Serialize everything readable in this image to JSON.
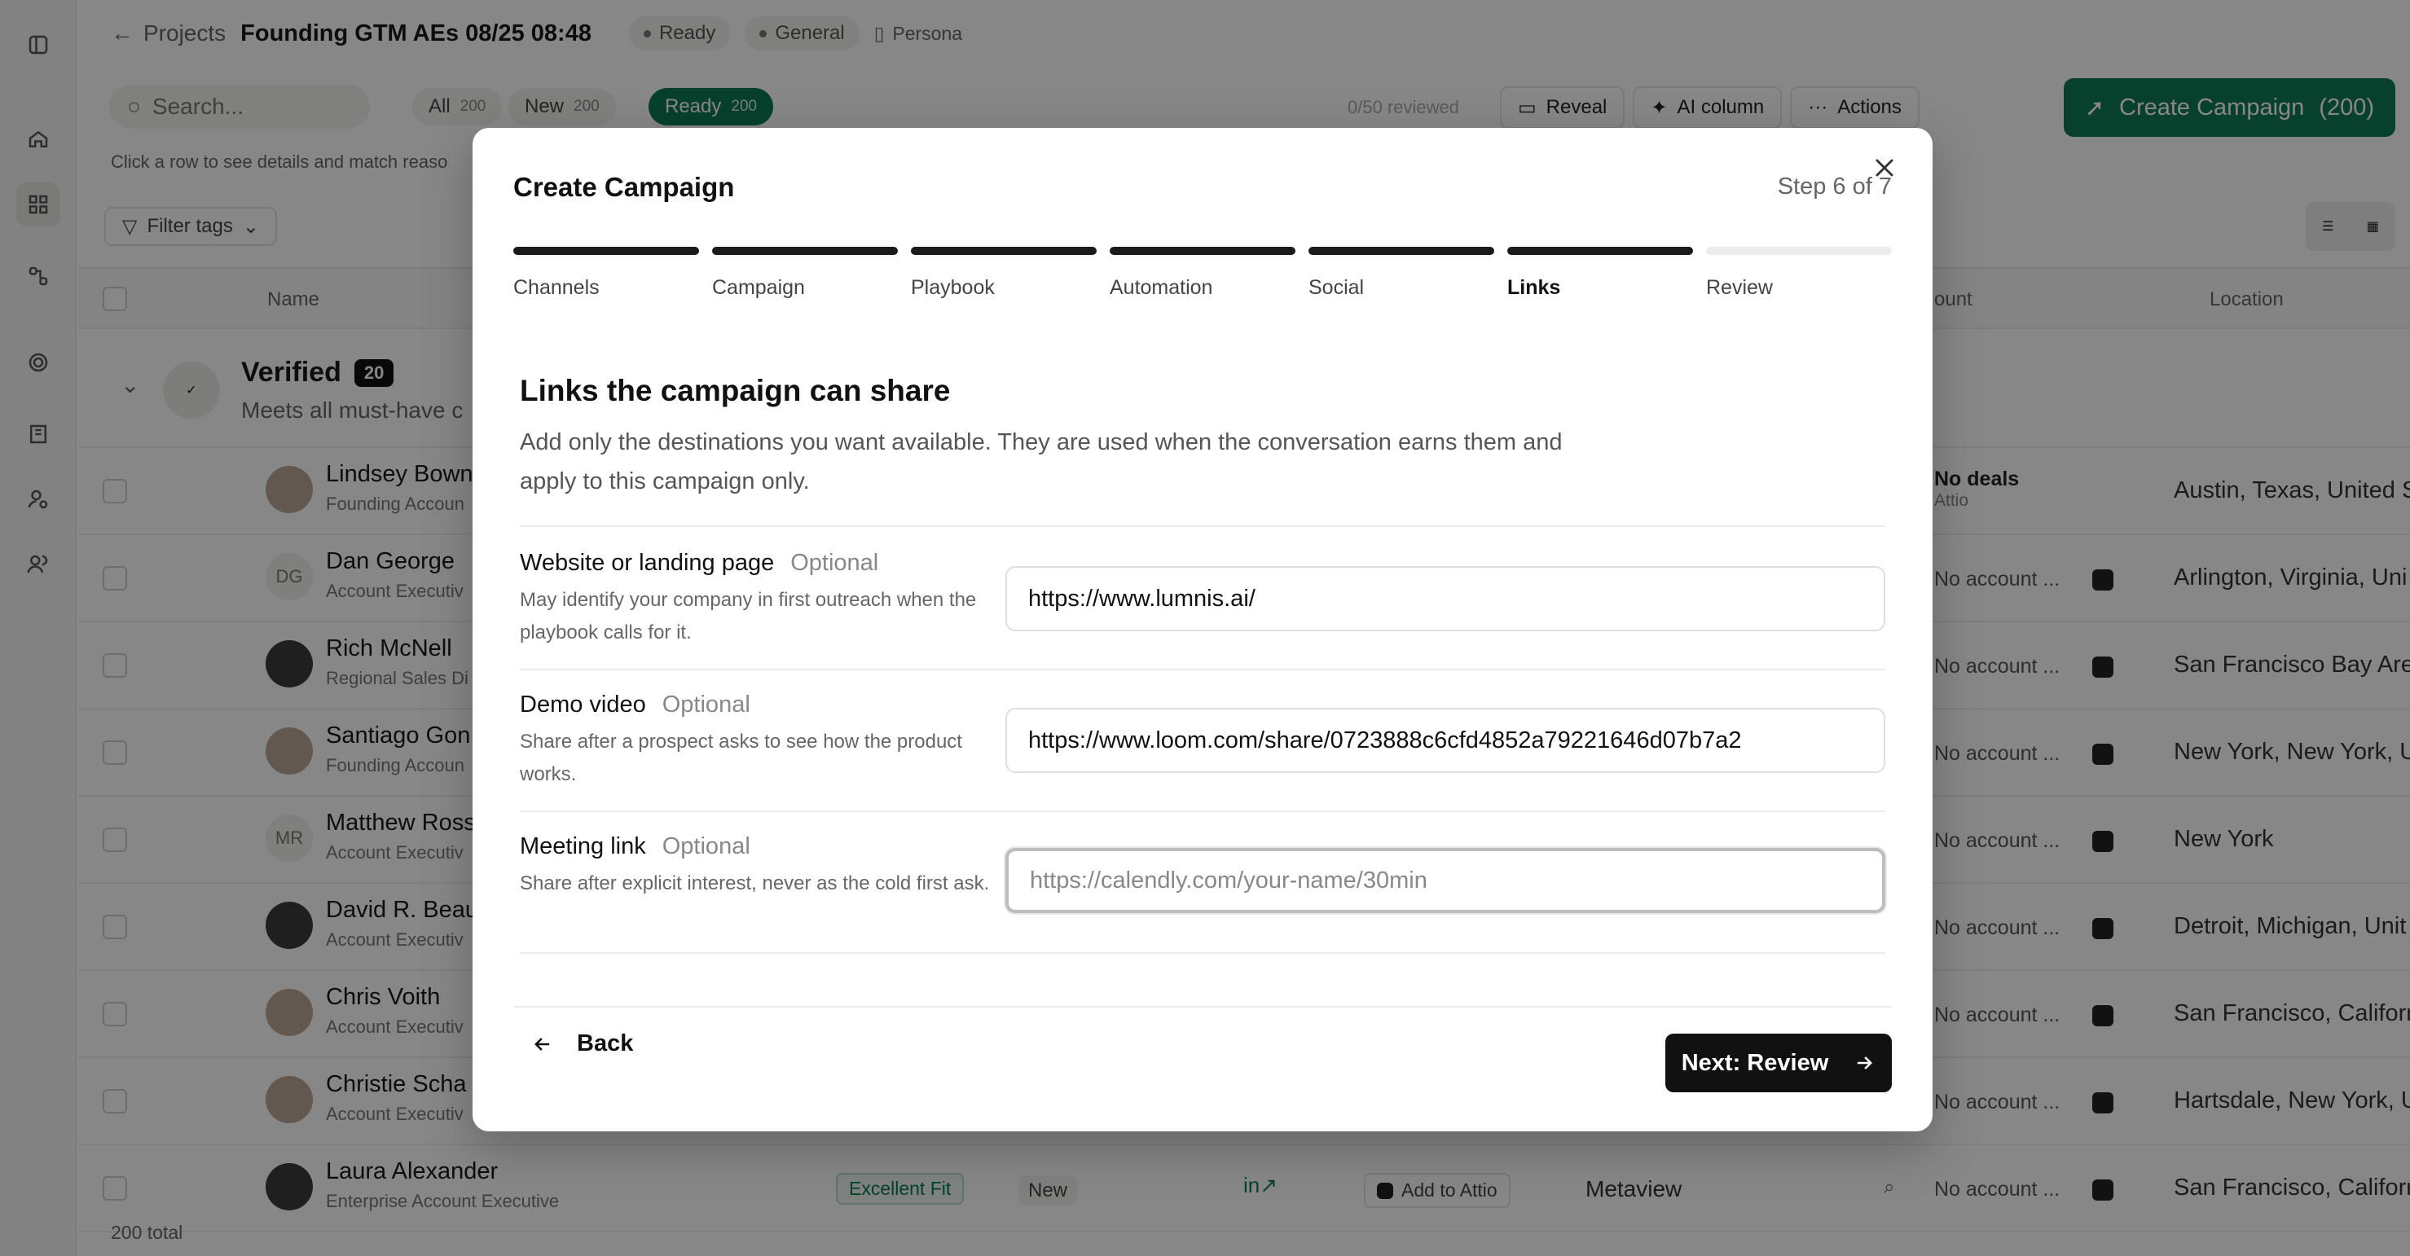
{
  "topbar": {
    "back_label": "Projects",
    "project_title": "Founding GTM AEs 08/25 08:48",
    "status_pill": "Ready",
    "category_pill": "General",
    "persona_label": "Persona"
  },
  "toolbar": {
    "search_placeholder": "Search...",
    "segments": [
      {
        "label": "All",
        "count": "200"
      },
      {
        "label": "New",
        "count": "200"
      },
      {
        "label": "Ready",
        "count": "200"
      }
    ],
    "reviewed": "0/50 reviewed",
    "reveal_label": "Reveal",
    "ai_column_label": "AI column",
    "actions_label": "Actions",
    "create_campaign_label": "Create Campaign",
    "create_campaign_count": "(200)"
  },
  "hint": "Click a row to see details and match reaso",
  "filter_label": "Filter tags",
  "table": {
    "col_name": "Name",
    "col_account": "ount",
    "col_location": "Location",
    "group": {
      "title": "Verified",
      "count": "20",
      "subtitle": "Meets all must-have c"
    },
    "rows": [
      {
        "name": "Lindsey Bown",
        "title": "Founding Accoun",
        "account": "No deals",
        "account_sub": "Attio",
        "location": "Austin, Texas, United S"
      },
      {
        "name": "Dan George",
        "title": "Account Executiv",
        "initials": "DG",
        "account": "No account ...",
        "location": "Arlington, Virginia, Uni"
      },
      {
        "name": "Rich McNell",
        "title": "Regional Sales Di",
        "account": "No account ...",
        "location": "San Francisco Bay Are"
      },
      {
        "name": "Santiago Gon",
        "title": "Founding Accoun",
        "account": "No account ...",
        "location": "New York, New York, U"
      },
      {
        "name": "Matthew Ross",
        "title": "Account Executiv",
        "initials": "MR",
        "account": "No account ...",
        "location": "New York"
      },
      {
        "name": "David R. Beau",
        "title": "Account Executiv",
        "account": "No account ...",
        "location": "Detroit, Michigan, Unit"
      },
      {
        "name": "Chris Voith",
        "title": "Account Executiv",
        "account": "No account ...",
        "location": "San Francisco, Califorr"
      },
      {
        "name": "Christie Scha",
        "title": "Account Executiv",
        "account": "No account ...",
        "location": "Hartsdale, New York, U"
      },
      {
        "name": "Laura Alexander",
        "title": "Enterprise Account Executive",
        "fit": "Excellent Fit",
        "status": "New",
        "attio": "Add to Attio",
        "company": "Metaview",
        "account": "No account ...",
        "location": "San Francisco, Califorr"
      }
    ],
    "total": "200 total"
  },
  "modal": {
    "title": "Create Campaign",
    "step_indicator": "Step 6 of 7",
    "steps": [
      "Channels",
      "Campaign",
      "Playbook",
      "Automation",
      "Social",
      "Links",
      "Review"
    ],
    "section_title": "Links the campaign can share",
    "section_desc": "Add only the destinations you want available. They are used when the conversation earns them and apply to this campaign only.",
    "fields": {
      "website": {
        "label": "Website or landing page",
        "optional": "Optional",
        "help": "May identify your company in first outreach when the playbook calls for it.",
        "value": "https://www.lumnis.ai/"
      },
      "demo": {
        "label": "Demo video",
        "optional": "Optional",
        "help": "Share after a prospect asks to see how the product works.",
        "value": "https://www.loom.com/share/0723888c6cfd4852a79221646d07b7a2"
      },
      "meeting": {
        "label": "Meeting link",
        "optional": "Optional",
        "help": "Share after explicit interest, never as the cold first ask.",
        "value": "",
        "placeholder": "https://calendly.com/your-name/30min"
      }
    },
    "back_label": "Back",
    "next_label": "Next: Review"
  }
}
